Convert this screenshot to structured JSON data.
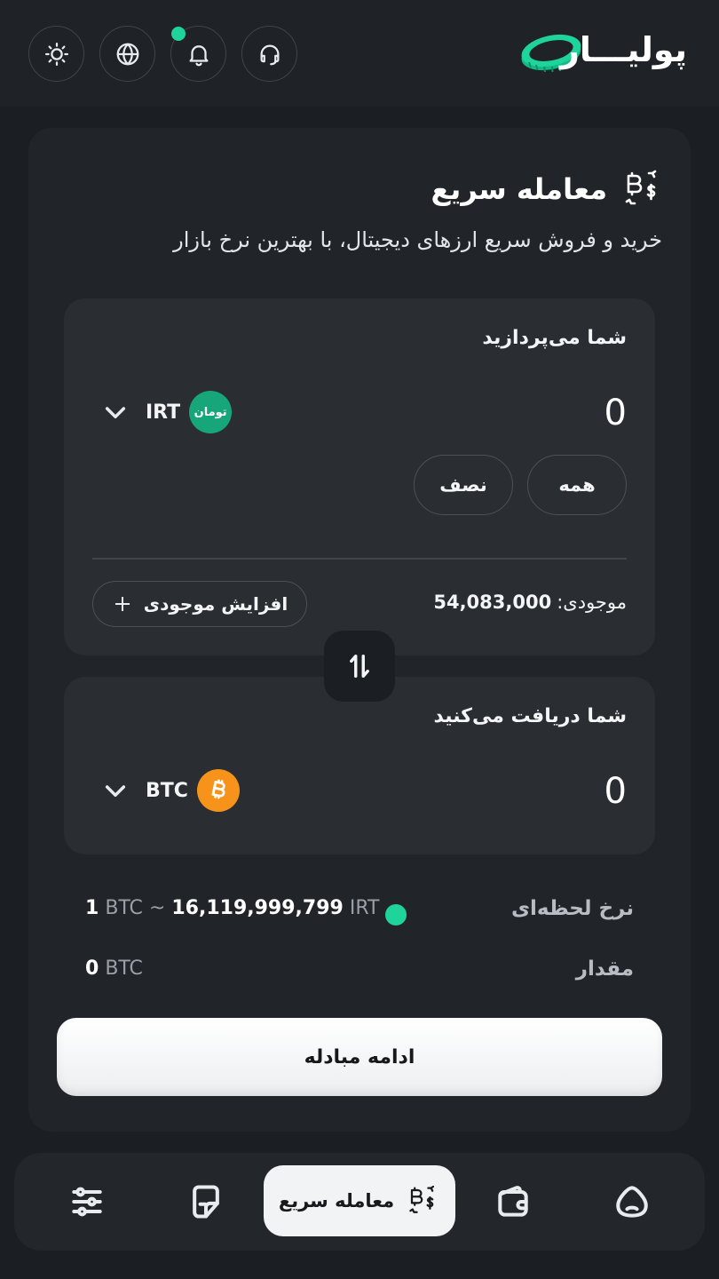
{
  "header": {
    "logo_text": "پولیـــار",
    "buttons": [
      "theme-toggle",
      "language",
      "notifications",
      "support"
    ]
  },
  "quick_trade": {
    "title": "معامله سریع",
    "subtitle": "خرید و فروش سریع ارزهای دیجیتال، با بهترین نرخ بازار"
  },
  "pay": {
    "label": "شما می‌پردازید",
    "amount": "0",
    "currency_code": "IRT",
    "currency_badge": "تومان",
    "all_label": "همه",
    "half_label": "نصف",
    "balance_label": "موجودی:",
    "balance_value": "54,083,000",
    "add_balance_label": "افزایش موجودی"
  },
  "receive": {
    "label": "شما دریافت می‌کنید",
    "amount": "0",
    "currency_code": "BTC"
  },
  "rate": {
    "label": "نرخ لحظه‌ای",
    "left_qty": "1",
    "left_unit": "BTC",
    "approx": "~",
    "value": "16,119,999,799",
    "unit": "IRT",
    "live_color": "#1ed49a"
  },
  "quantity": {
    "label": "مقدار",
    "value": "0",
    "unit": "BTC"
  },
  "cta": {
    "label": "ادامه مبادله"
  },
  "bottom_nav": {
    "active_label": "معامله سریع",
    "items": [
      "settings-sliders-icon",
      "orders-icon",
      "quick-trade-icon",
      "wallet-icon",
      "home-icon"
    ]
  },
  "colors": {
    "accent": "#1ed49a",
    "btc": "#f7931a",
    "toman": "#17a67a",
    "background": "#1b1e22"
  }
}
